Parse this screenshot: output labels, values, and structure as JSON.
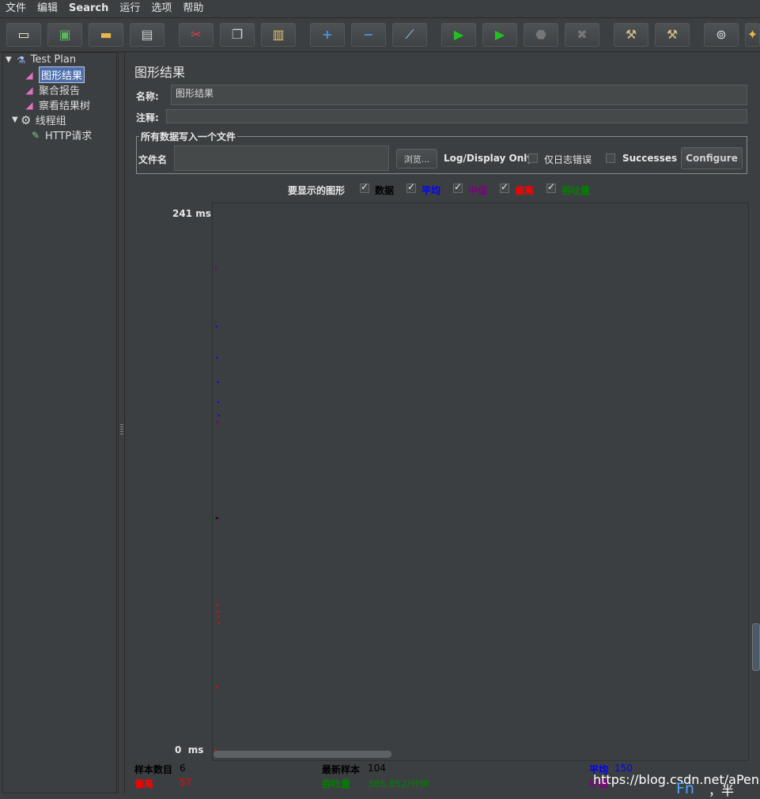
{
  "menu": [
    "文件",
    "编辑",
    "Search",
    "运行",
    "选项",
    "帮助"
  ],
  "toolbar_icons": [
    "new-icon",
    "templates-icon",
    "open-icon",
    "save-icon",
    "cut-icon",
    "copy-icon",
    "paste-icon",
    "expand-icon",
    "collapse-icon",
    "toggle-icon",
    "start-icon",
    "start-no-pause-icon",
    "stop-icon",
    "shutdown-icon",
    "clear-icon",
    "clear-all-icon",
    "search-icon",
    "function-helper-icon"
  ],
  "tree": {
    "items": [
      {
        "label": "Test Plan",
        "icon": "flask-icon"
      },
      {
        "label": "图形结果",
        "icon": "graph-icon"
      },
      {
        "label": "聚合报告",
        "icon": "graph-icon"
      },
      {
        "label": "察看结果树",
        "icon": "graph-icon"
      },
      {
        "label": "线程组",
        "icon": "gear-icon"
      },
      {
        "label": "HTTP请求",
        "icon": "pipette-icon"
      }
    ]
  },
  "panel": {
    "title": "图形结果",
    "name_label": "名称:",
    "name_value": "图形结果",
    "comment_label": "注释:",
    "comment_value": "",
    "file_group_title": "所有数据写入一个文件",
    "filename_label": "文件名",
    "filename_value": "",
    "browse_label": "浏览...",
    "log_display_label": "Log/Display Only:",
    "errors_only_label": "仅日志错误",
    "successes_label": "Successes",
    "configure_label": "Configure"
  },
  "graph_options": {
    "title": "要显示的图形",
    "items": [
      {
        "label": "数据",
        "checked": true,
        "color": "#000000"
      },
      {
        "label": "平均",
        "checked": true,
        "color": "#0000ff"
      },
      {
        "label": "中值",
        "checked": true,
        "color": "#800080"
      },
      {
        "label": "偏离",
        "checked": true,
        "color": "#ff0000"
      },
      {
        "label": "吞吐量",
        "checked": true,
        "color": "#008000"
      }
    ]
  },
  "chart_data": {
    "type": "scatter",
    "y_max_label": "241",
    "y_min_label": "0",
    "y_unit": "ms",
    "ylim": [
      0,
      241
    ],
    "series": [
      {
        "name": "数据",
        "color": "#000000",
        "x": [
          1,
          2,
          3,
          4,
          5,
          6
        ],
        "y": [
          216,
          104,
          147,
          104,
          104,
          104
        ]
      },
      {
        "name": "平均",
        "color": "#0000ff",
        "x": [
          1,
          2,
          3,
          4,
          5,
          6
        ],
        "y": [
          216,
          190,
          176,
          165,
          156,
          150
        ]
      },
      {
        "name": "中值",
        "color": "#800080",
        "x": [
          1,
          2,
          3,
          4,
          5,
          6
        ],
        "y": [
          216,
          216,
          147,
          147,
          104,
          104
        ]
      },
      {
        "name": "偏离",
        "color": "#ff0000",
        "x": [
          1,
          2,
          3,
          4,
          5,
          6
        ],
        "y": [
          0,
          28,
          65,
          62,
          60,
          57
        ]
      }
    ]
  },
  "stats": {
    "samples_label": "样本数目",
    "samples_value": "6",
    "latest_label": "最新样本",
    "latest_value": "104",
    "average_label": "平均",
    "average_value": "150",
    "deviation_label": "偏离",
    "deviation_value": "57",
    "throughput_label": "吞吐量",
    "throughput_value": "385.852/分钟",
    "median_label": "中值"
  },
  "watermark": "https://blog.csdn.net/aPeng7",
  "ime": {
    "mode": "Fn",
    "width": "，半"
  }
}
